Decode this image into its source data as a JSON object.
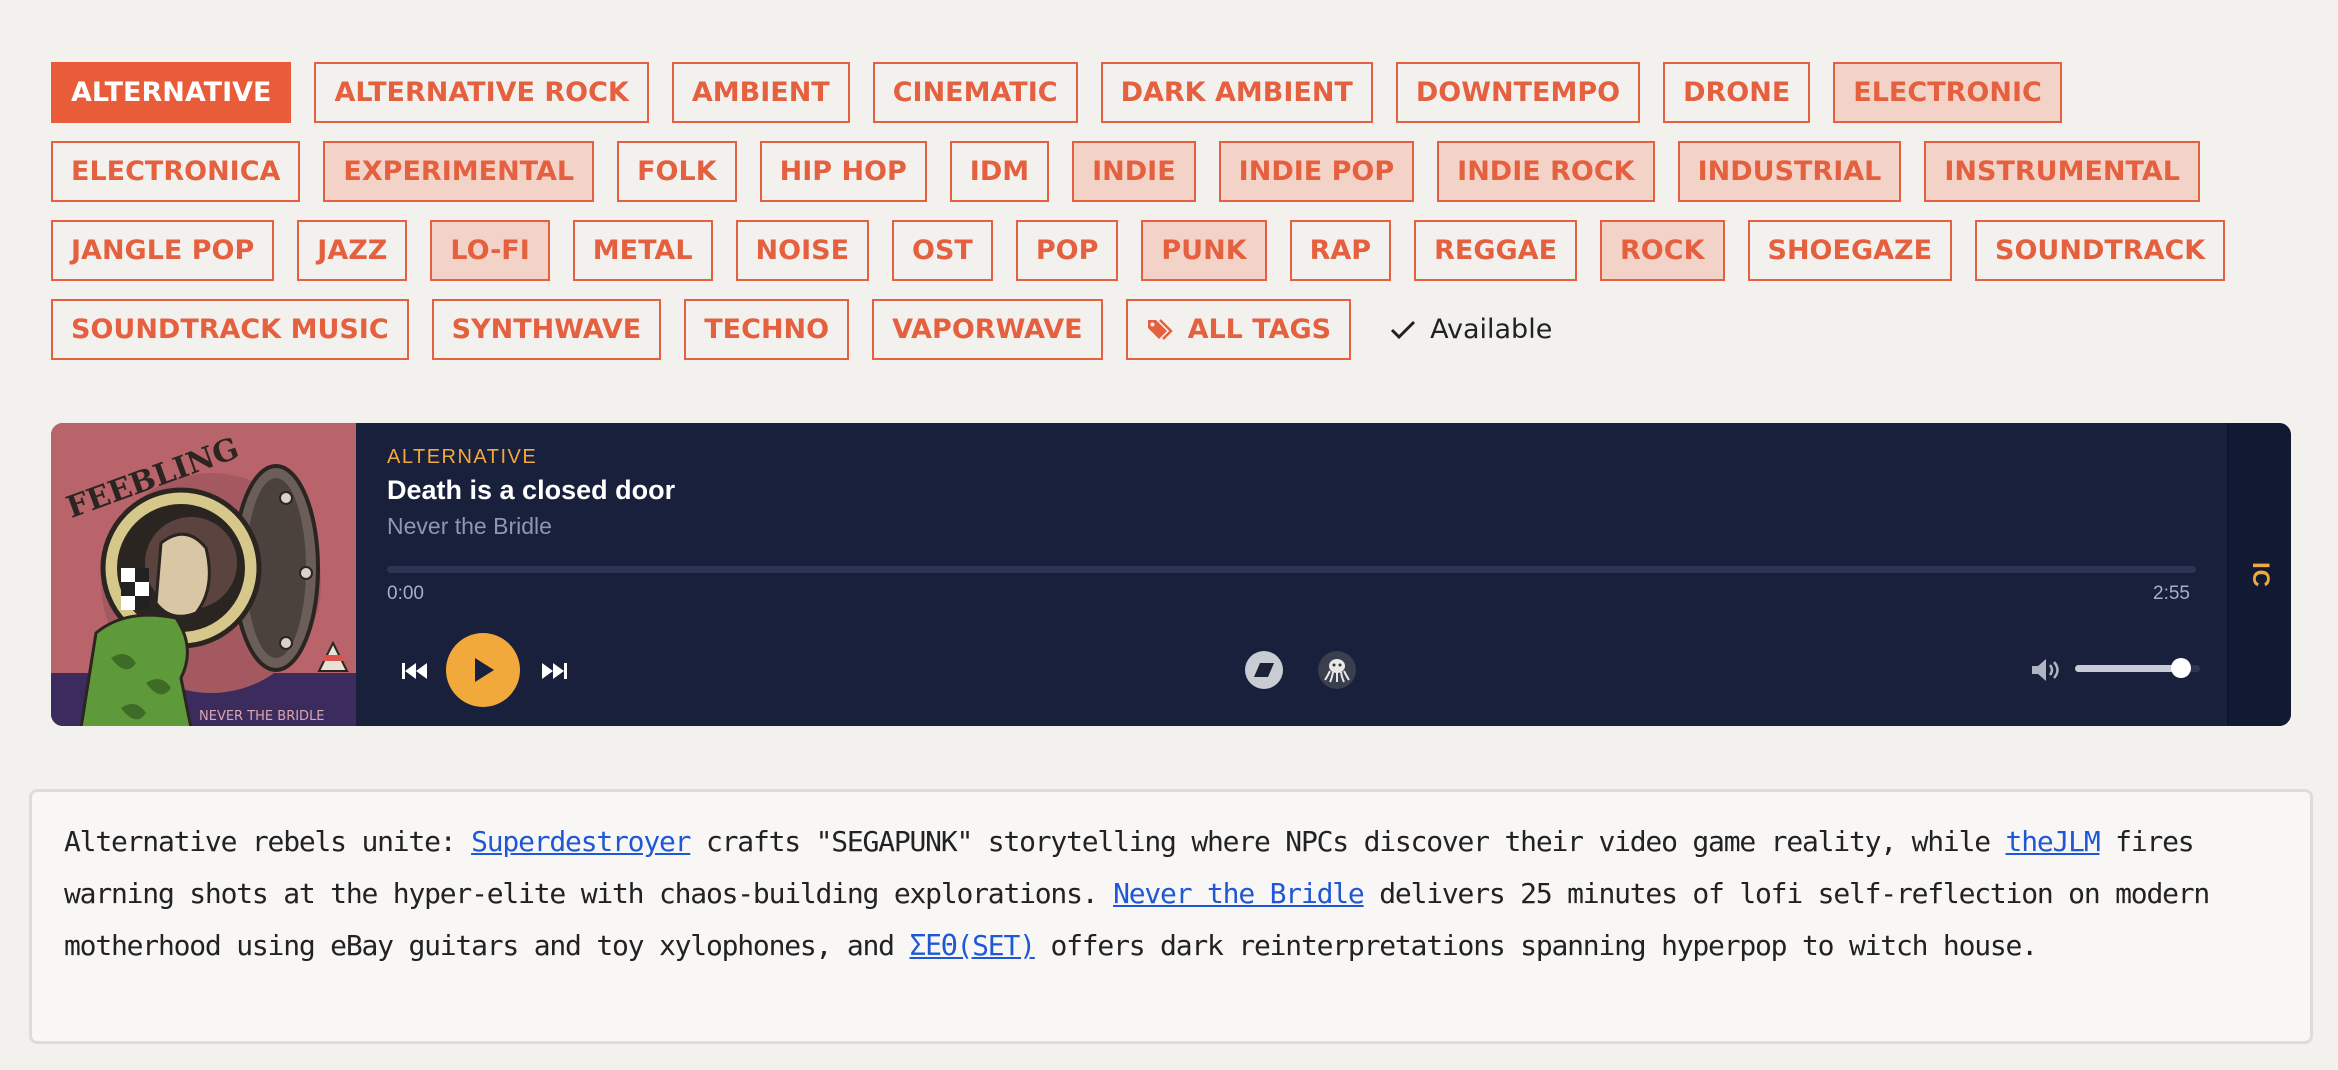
{
  "tags": [
    {
      "label": "ALTERNATIVE",
      "state": "active"
    },
    {
      "label": "ALTERNATIVE ROCK",
      "state": "normal"
    },
    {
      "label": "AMBIENT",
      "state": "normal"
    },
    {
      "label": "CINEMATIC",
      "state": "normal"
    },
    {
      "label": "DARK AMBIENT",
      "state": "normal"
    },
    {
      "label": "DOWNTEMPO",
      "state": "normal"
    },
    {
      "label": "DRONE",
      "state": "normal"
    },
    {
      "label": "ELECTRONIC",
      "state": "highlighted"
    },
    {
      "label": "ELECTRONICA",
      "state": "normal"
    },
    {
      "label": "EXPERIMENTAL",
      "state": "highlighted"
    },
    {
      "label": "FOLK",
      "state": "normal"
    },
    {
      "label": "HIP HOP",
      "state": "normal"
    },
    {
      "label": "IDM",
      "state": "normal"
    },
    {
      "label": "INDIE",
      "state": "highlighted"
    },
    {
      "label": "INDIE POP",
      "state": "highlighted"
    },
    {
      "label": "INDIE ROCK",
      "state": "highlighted"
    },
    {
      "label": "INDUSTRIAL",
      "state": "highlighted"
    },
    {
      "label": "INSTRUMENTAL",
      "state": "highlighted"
    },
    {
      "label": "JANGLE POP",
      "state": "normal"
    },
    {
      "label": "JAZZ",
      "state": "normal"
    },
    {
      "label": "LO-FI",
      "state": "highlighted"
    },
    {
      "label": "METAL",
      "state": "normal"
    },
    {
      "label": "NOISE",
      "state": "normal"
    },
    {
      "label": "OST",
      "state": "normal"
    },
    {
      "label": "POP",
      "state": "normal"
    },
    {
      "label": "PUNK",
      "state": "highlighted"
    },
    {
      "label": "RAP",
      "state": "normal"
    },
    {
      "label": "REGGAE",
      "state": "normal"
    },
    {
      "label": "ROCK",
      "state": "highlighted"
    },
    {
      "label": "SHOEGAZE",
      "state": "normal"
    },
    {
      "label": "SOUNDTRACK",
      "state": "normal"
    },
    {
      "label": "SOUNDTRACK MUSIC",
      "state": "normal"
    },
    {
      "label": "SYNTHWAVE",
      "state": "normal"
    },
    {
      "label": "TECHNO",
      "state": "normal"
    },
    {
      "label": "VAPORWAVE",
      "state": "normal"
    }
  ],
  "all_tags": {
    "label": "ALL TAGS",
    "icon": "tags-icon"
  },
  "available": {
    "label": "Available",
    "icon": "check-icon"
  },
  "player": {
    "genre": "ALTERNATIVE",
    "title": "Death is a closed door",
    "artist": "Never the Bridle",
    "time_current": "0:00",
    "time_duration": "2:55",
    "progress": 0,
    "volume": 0.85,
    "side_label": "IC",
    "cover_text_top": "FEEBLING",
    "cover_text_bottom": "NEVER THE BRIDLE",
    "icons": [
      "skip-back-icon",
      "play-icon",
      "skip-forward-icon",
      "bandcamp-icon",
      "octopus-icon",
      "volume-icon"
    ]
  },
  "description": {
    "t1": "Alternative rebels unite: ",
    "link1": "Superdestroyer",
    "t2": " crafts \"SEGAPUNK\" storytelling where NPCs discover their video game reality, while ",
    "link2": "theJLM",
    "t3": " fires warning shots at the hyper-elite with chaos-building explorations. ",
    "link3": "Never the Bridle",
    "t4": " delivers 25 minutes of lofi self-reflection on modern motherhood using eBay guitars and toy xylophones, and ",
    "link4": "ΣΕΘ(SET)",
    "t5": " offers dark reinterpretations spanning hyperpop to witch house."
  },
  "colors": {
    "accent": "#e4603f",
    "tag_highlight": "#f3d3c7",
    "player_bg": "#18203c",
    "player_accent": "#f2a93b",
    "link": "#1f58d6"
  }
}
